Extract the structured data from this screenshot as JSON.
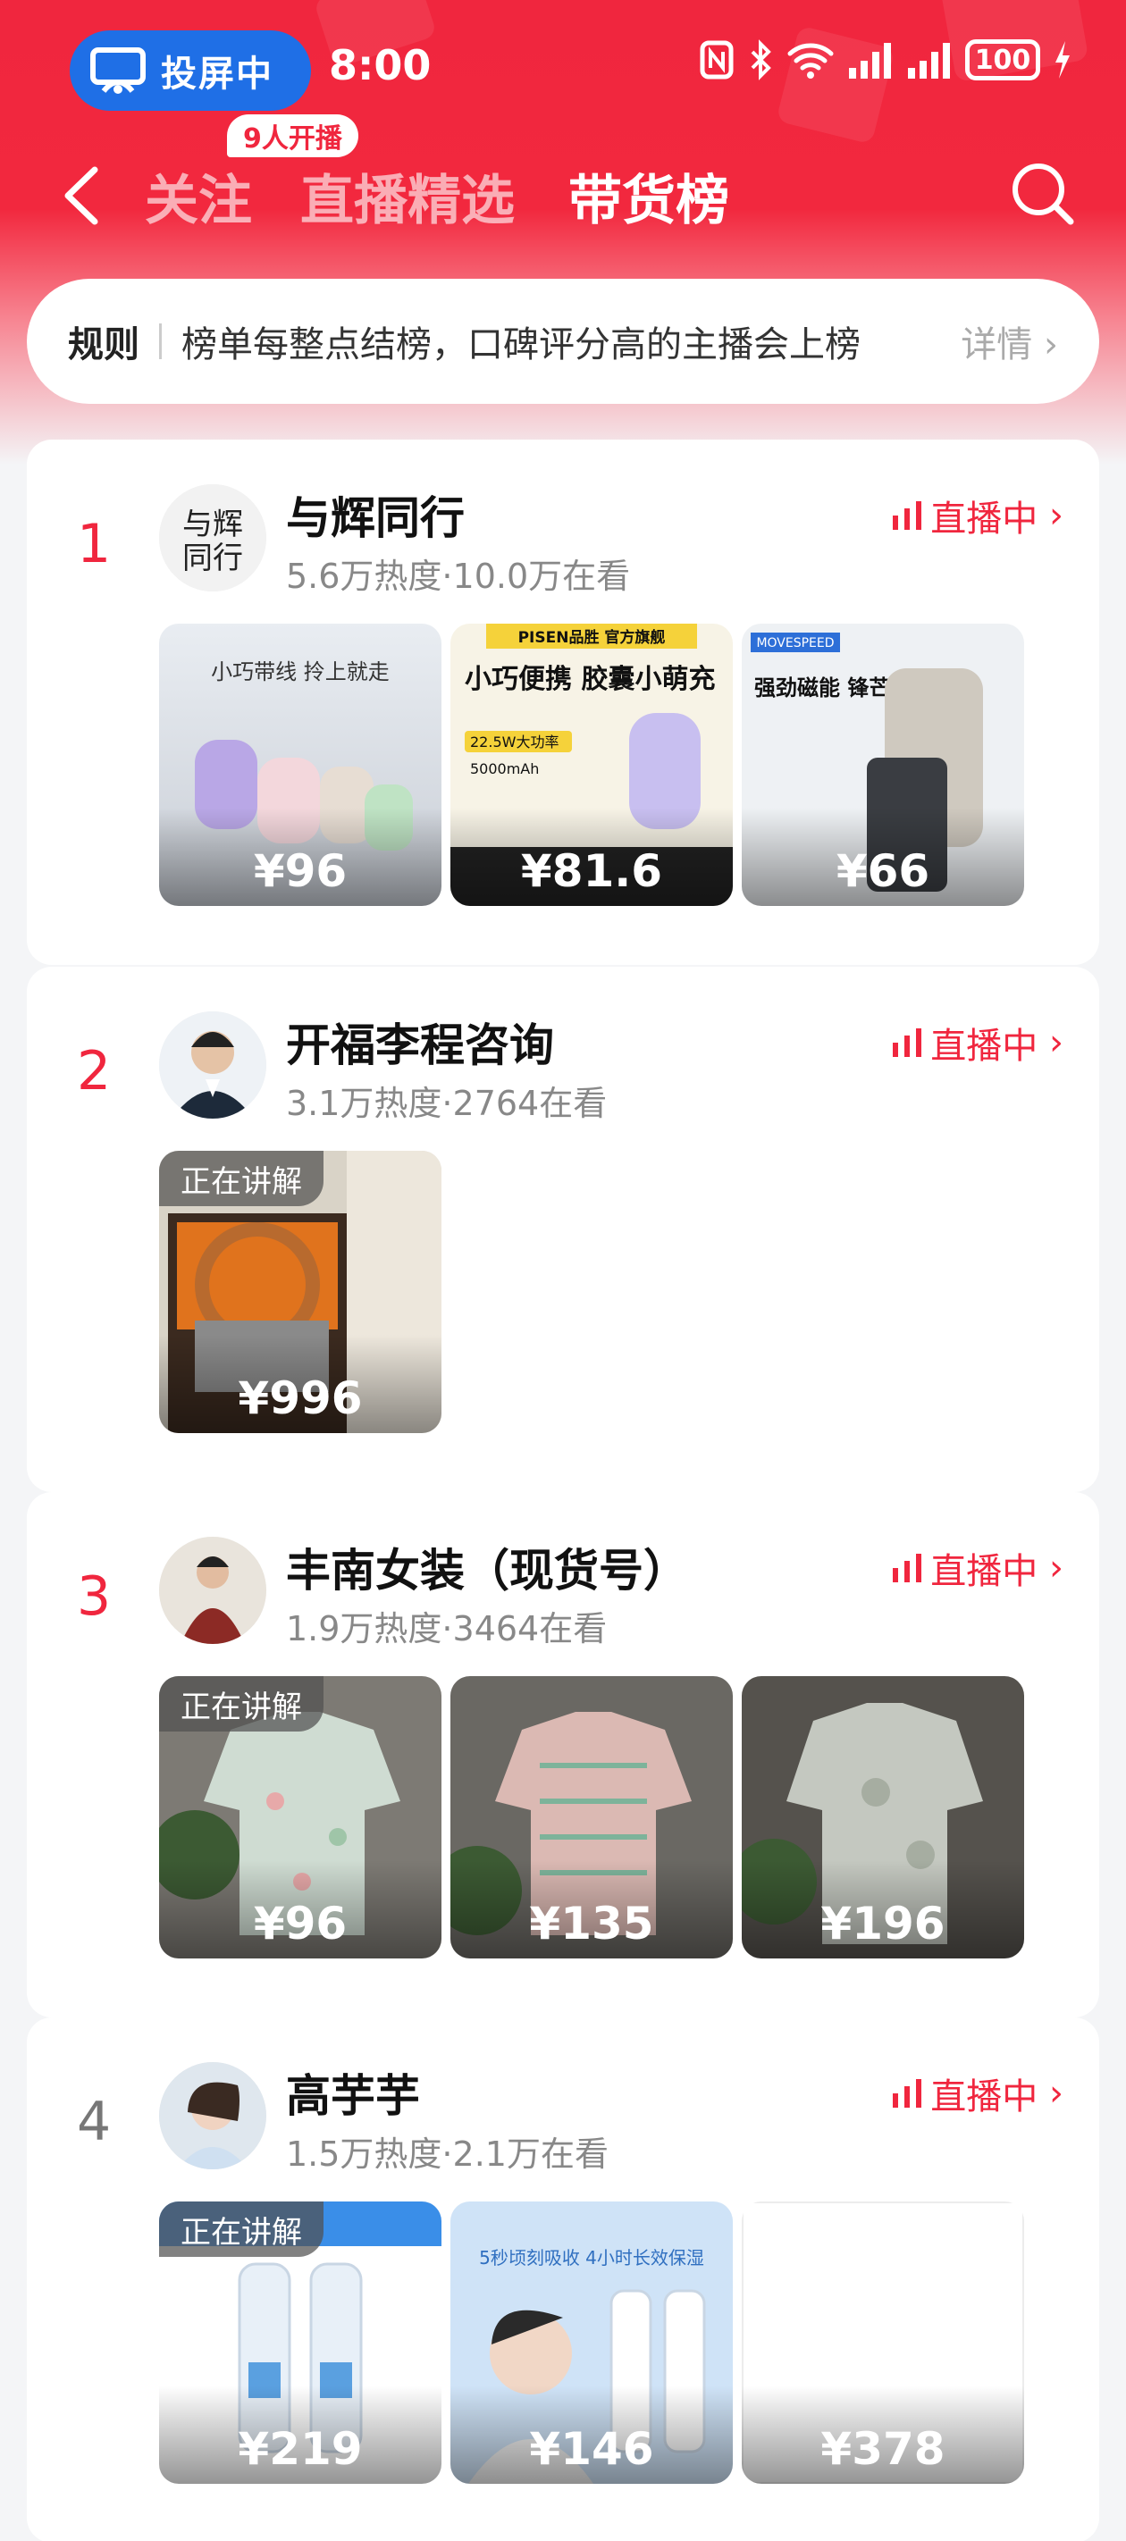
{
  "status_bar": {
    "cast_label": "投屏中",
    "time": "8:00",
    "battery": "100"
  },
  "nav": {
    "tabs": [
      {
        "label": "关注"
      },
      {
        "label": "直播精选"
      },
      {
        "label": "带货榜"
      }
    ],
    "follow_badge": "9人开播"
  },
  "rule": {
    "label": "规则",
    "text": "榜单每整点结榜，口碑评分高的主播会上榜",
    "more": "详情"
  },
  "colors": {
    "brand_red": "#f0263e",
    "cast_blue": "#1f6fe6"
  },
  "streamers": [
    {
      "rank": "1",
      "name": "与辉同行",
      "meta": "5.6万热度·10.0万在看",
      "live_label": "直播中",
      "avatar_text": "与辉同行",
      "products": [
        {
          "price": "¥96"
        },
        {
          "price": "¥81.6"
        },
        {
          "price": "¥66"
        }
      ]
    },
    {
      "rank": "2",
      "name": "开福李程咨询",
      "meta": "3.1万热度·2764在看",
      "live_label": "直播中",
      "explaining": "正在讲解",
      "products": [
        {
          "price": "¥996"
        }
      ]
    },
    {
      "rank": "3",
      "name": "丰南女装（现货号）",
      "meta": "1.9万热度·3464在看",
      "live_label": "直播中",
      "explaining": "正在讲解",
      "products": [
        {
          "price": "¥96"
        },
        {
          "price": "¥135"
        },
        {
          "price": "¥196"
        }
      ]
    },
    {
      "rank": "4",
      "name": "高芋芋",
      "meta": "1.5万热度·2.1万在看",
      "live_label": "直播中",
      "explaining": "正在讲解",
      "products": [
        {
          "price": "¥219"
        },
        {
          "price": "¥146"
        },
        {
          "price": "¥378"
        }
      ]
    }
  ],
  "product_texts": {
    "p1a": "小巧带线 拎上就走",
    "p1b_brand": "PISEN品胜 官方旗舰",
    "p1b_title": "小巧便携 胶囊小萌充",
    "p1b_spec1": "22.5W大功率",
    "p1b_spec2": "5000mAh",
    "p1c_brand": "MOVESPEED",
    "p1c_title": "强劲磁能 锋芒毕露",
    "p4b_title": "5秒顷刻吸收 4小时长效保湿"
  }
}
